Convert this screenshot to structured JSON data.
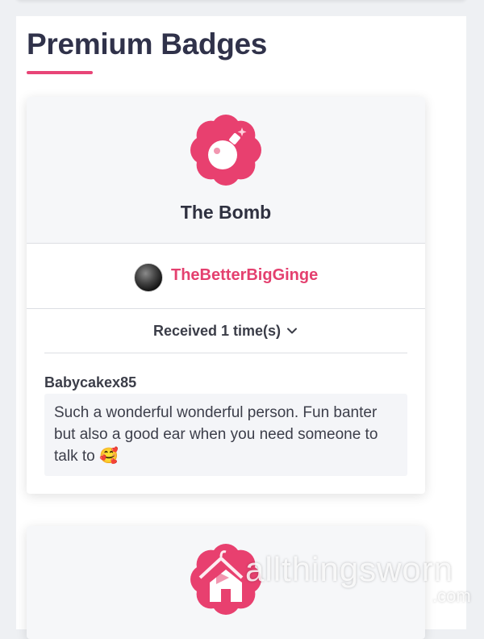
{
  "section": {
    "title": "Premium Badges"
  },
  "badges": [
    {
      "name": "The Bomb",
      "icon": "bomb-icon",
      "awarder": "TheBetterBigGinge",
      "received_label": "Received 1 time(s)",
      "reviews": [
        {
          "author": "Babycakex85",
          "text": "Such a wonderful wonderful person. Fun banter but also a good ear when you need someone to talk to",
          "emoji": "🥰"
        }
      ]
    },
    {
      "icon": "house-icon"
    }
  ],
  "watermark": {
    "text": "allthingsworn",
    "suffix": ".com"
  },
  "colors": {
    "accent": "#e84577",
    "badge": "#e8406f",
    "text": "#2f3140"
  }
}
